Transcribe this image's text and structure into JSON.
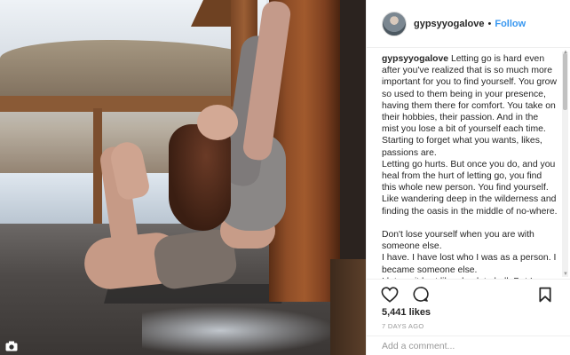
{
  "post": {
    "username": "gypsyyogalove",
    "separator": "•",
    "follow_label": "Follow",
    "caption_user": "gypsyyogalove",
    "caption_text": " Letting go is hard even after you've realized that is so much more important for you to find yourself. You grow so used to them being in your presence, having them there for comfort. You take on their hobbies, their passion. And in the mist you lose a bit of yourself each time. Starting to forget what you wants, likes, passions are.\nLetting go hurts. But once you do, and you heal from the hurt of letting go, you find this whole new person. You find yourself. Like wandering deep in the wilderness and finding the oasis in the middle of no-where.\n\nDon't lose yourself when you are with someone else.\nI have. I have lost who I was as a person. I became someone else.\nI let go, it hurt like absolute hell. But I",
    "likes": "5,441 likes",
    "timestamp": "7 DAYS AGO",
    "comment_placeholder": "Add a comment..."
  },
  "icons": {
    "like": "heart-icon",
    "comment": "comment-icon",
    "save": "bookmark-icon",
    "media": "camera-icon"
  },
  "colors": {
    "accent": "#3897f0",
    "text": "#262626",
    "muted": "#999999",
    "border": "#efefef"
  }
}
